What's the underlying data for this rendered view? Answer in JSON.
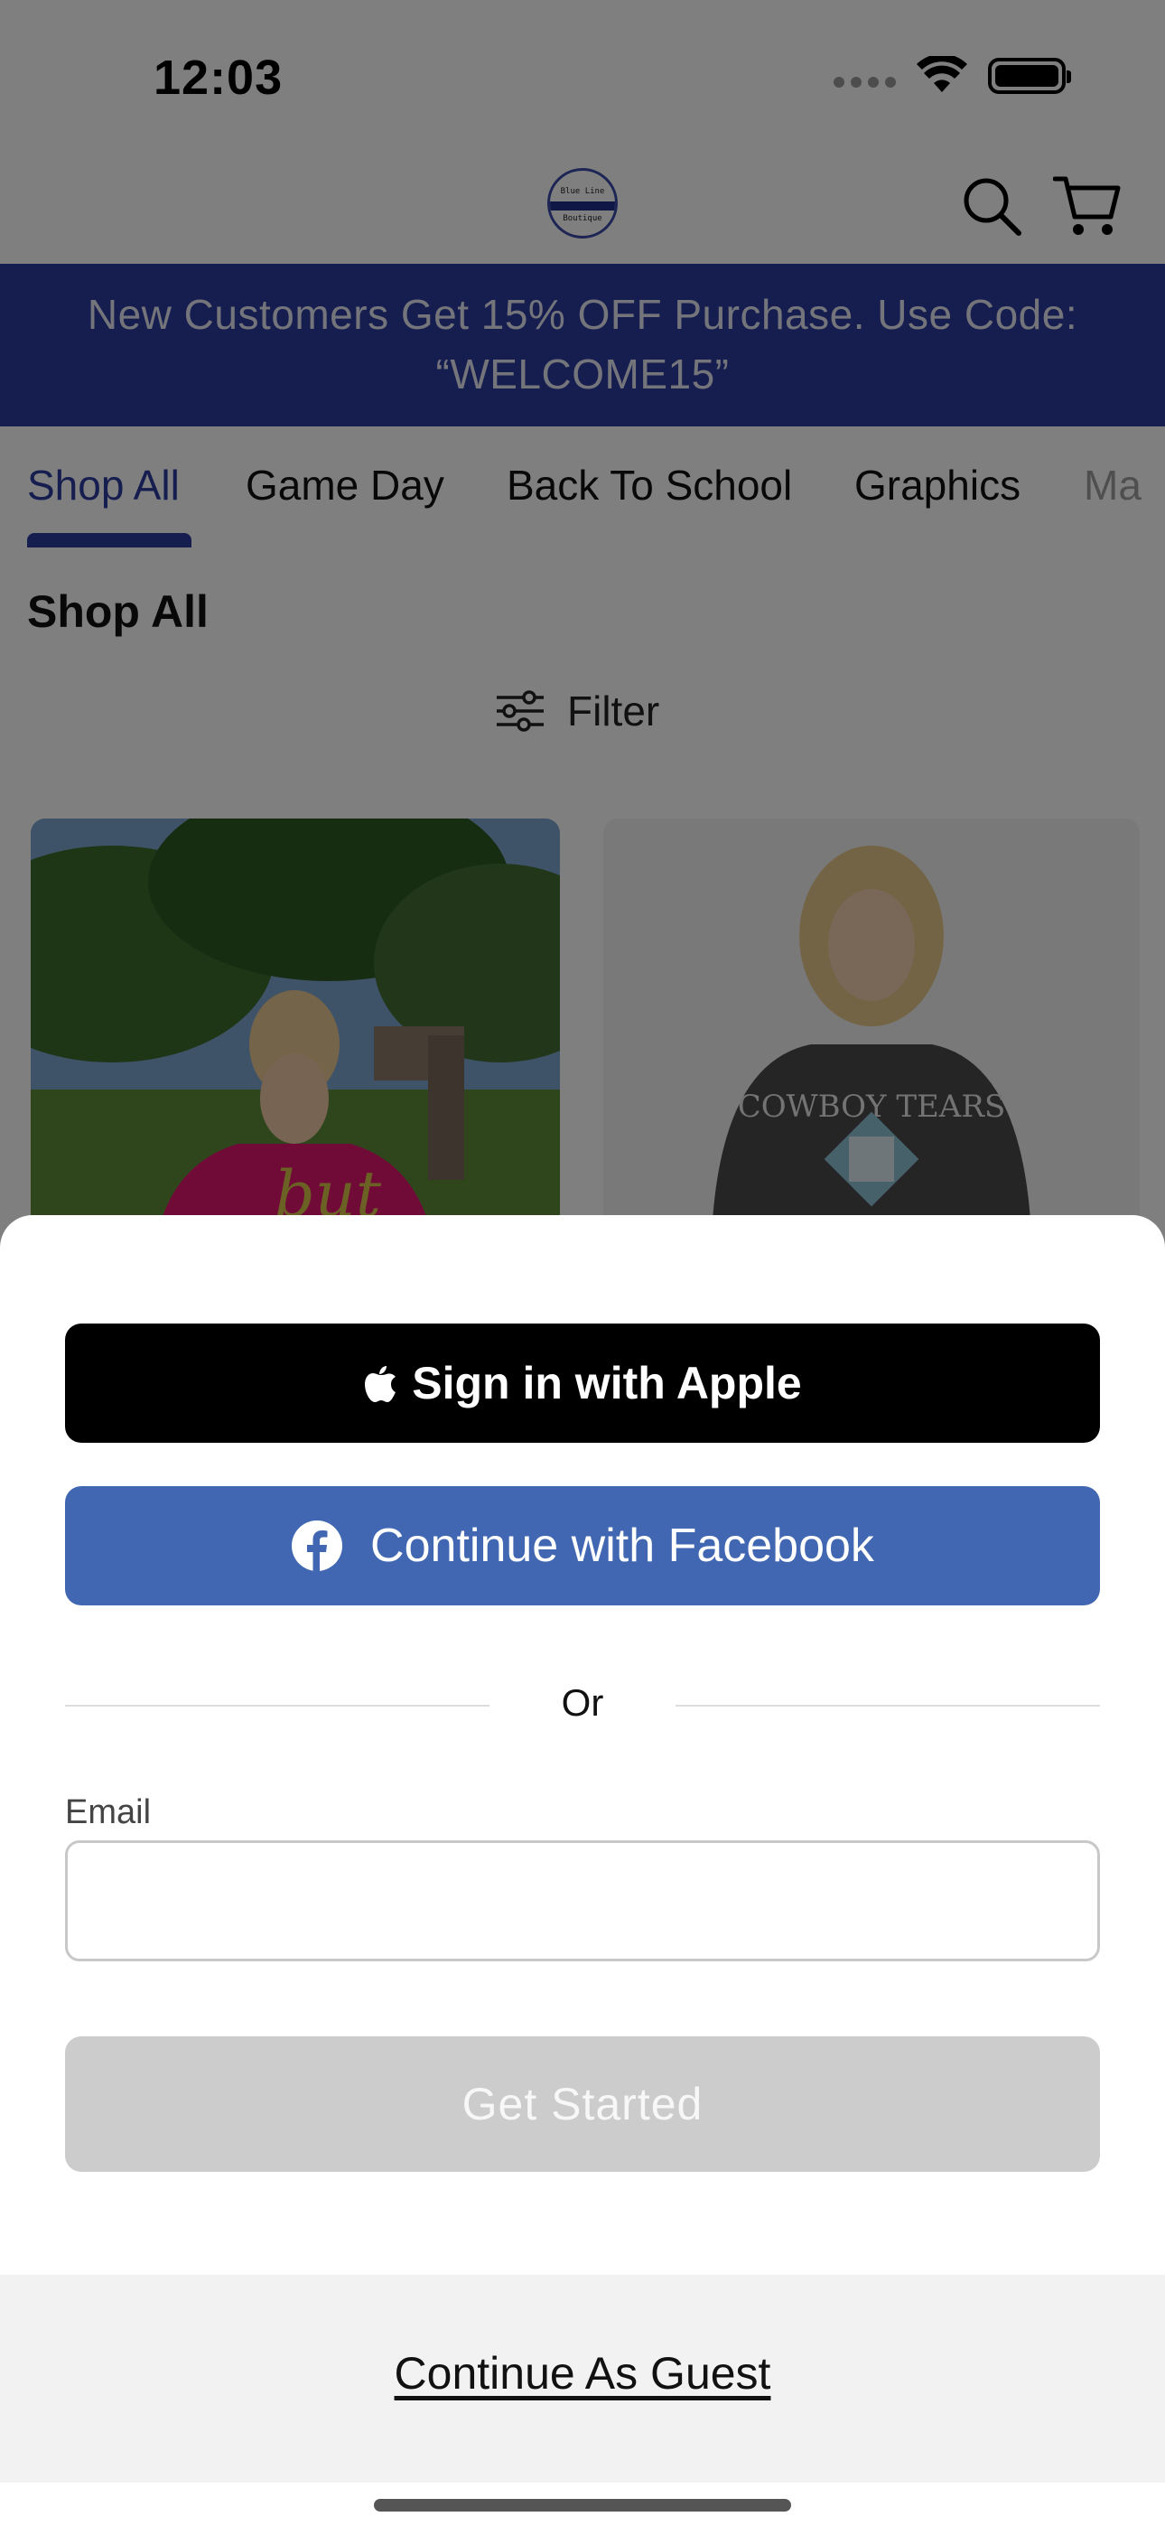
{
  "status_bar": {
    "time": "12:03"
  },
  "header": {
    "logo": {
      "line1": "Blue Line",
      "line2": "Boutique"
    },
    "icons": [
      "search-icon",
      "cart-icon"
    ]
  },
  "promo": {
    "text": "New Customers Get 15% OFF Purchase. Use Code: “WELCOME15”"
  },
  "tabs": [
    {
      "label": "Shop All",
      "active": true
    },
    {
      "label": "Game Day",
      "active": false
    },
    {
      "label": "Back To School",
      "active": false
    },
    {
      "label": "Graphics",
      "active": false
    },
    {
      "label": "Ma",
      "active": false
    }
  ],
  "section_title": "Shop All",
  "filter_label": "Filter",
  "sheet": {
    "apple_button": "Sign in with Apple",
    "facebook_button": "Continue with Facebook",
    "divider_text": "Or",
    "email": {
      "label": "Email",
      "placeholder": "",
      "value": ""
    },
    "get_started_button": "Get Started",
    "guest_link": "Continue As Guest"
  },
  "colors": {
    "brand": "#2c3a9e",
    "facebook": "#4267b2",
    "apple": "#000000",
    "disabled": "#cccccc"
  }
}
